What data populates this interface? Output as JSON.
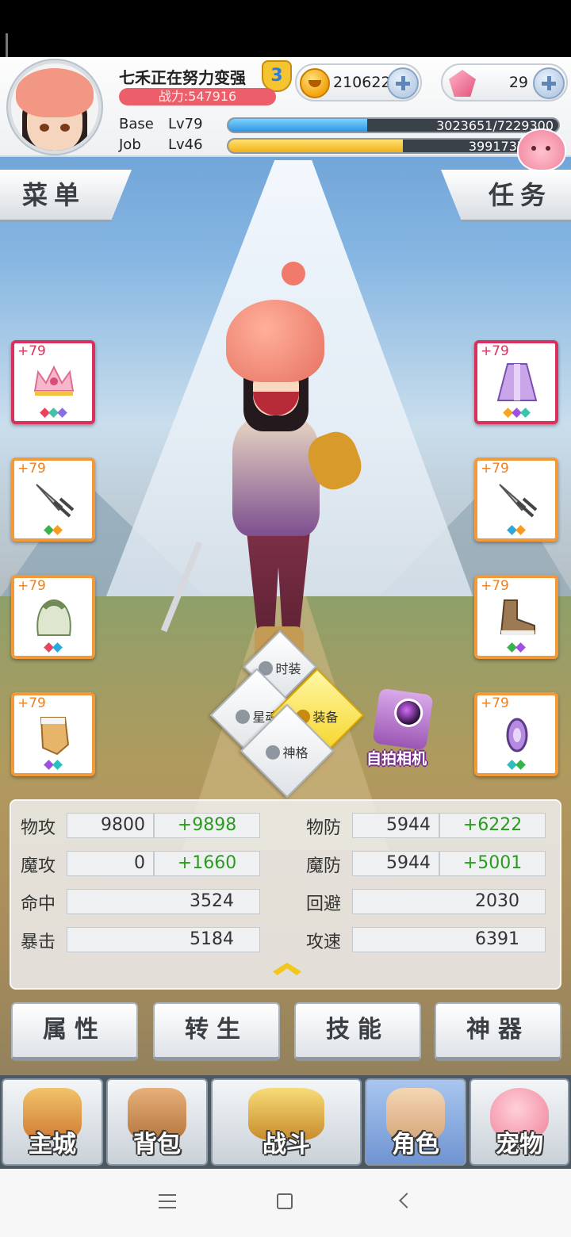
{
  "player": {
    "name": "七禾正在努力变强",
    "vip_level": "3",
    "power": "战力:547916"
  },
  "currency": {
    "gold": "210622",
    "gems": "29"
  },
  "levels": {
    "base_label": "Base",
    "base_level": "Lv79",
    "base_exp": "3023651/7229300",
    "base_progress": 0.42,
    "job_label": "Job",
    "job_level": "Lv46",
    "job_exp": "3991737/753",
    "job_progress": 0.53
  },
  "tabs": {
    "menu": "菜单",
    "task": "任务"
  },
  "equipment": {
    "left": [
      {
        "level": "+79",
        "item": "crown-icon",
        "gems": [
          "#e8445d",
          "#3cc3a8",
          "#8a6fe0"
        ]
      },
      {
        "level": "+79",
        "item": "katar-icon",
        "gems": [
          "#34b44a",
          "#f59a23"
        ]
      },
      {
        "level": "+79",
        "item": "hood-icon",
        "gems": [
          "#e8445d",
          "#2aa7e0"
        ]
      },
      {
        "level": "+79",
        "item": "glove-icon",
        "gems": [
          "#a050e0",
          "#2ac0c0"
        ]
      }
    ],
    "right": [
      {
        "level": "+79",
        "item": "robe-icon",
        "gems": [
          "#f5a623",
          "#a050e0",
          "#3cc3a8"
        ]
      },
      {
        "level": "+79",
        "item": "katar-icon",
        "gems": [
          "#2aa7e0",
          "#f59a23"
        ]
      },
      {
        "level": "+79",
        "item": "boots-icon",
        "gems": [
          "#34b44a",
          "#a050e0"
        ]
      },
      {
        "level": "+79",
        "item": "accessory-icon",
        "gems": [
          "#2ac0c0",
          "#34b44a"
        ]
      }
    ]
  },
  "radial_menu": {
    "costume": "时装",
    "star_soul": "星魂",
    "equipment": "装备",
    "divinity": "神格"
  },
  "selfie_camera": "自拍相机",
  "stats": {
    "atk_label": "物攻",
    "atk_base": "9800",
    "atk_bonus": "+9898",
    "def_label": "物防",
    "def_base": "5944",
    "def_bonus": "+6222",
    "matk_label": "魔攻",
    "matk_base": "0",
    "matk_bonus": "+1660",
    "mdef_label": "魔防",
    "mdef_base": "5944",
    "mdef_bonus": "+5001",
    "hit_label": "命中",
    "hit_value": "3524",
    "flee_label": "回避",
    "flee_value": "2030",
    "crit_label": "暴击",
    "crit_value": "5184",
    "aspd_label": "攻速",
    "aspd_value": "6391"
  },
  "function_buttons": [
    "属性",
    "转生",
    "技能",
    "神器"
  ],
  "bottom_nav": [
    "主城",
    "背包",
    "战斗",
    "角色",
    "宠物"
  ],
  "colors": {
    "accent_orange": "#f29a3a",
    "accent_pink": "#d9315b",
    "bonus_green": "#2b9b1f",
    "active_tab": "#6f94d2"
  }
}
